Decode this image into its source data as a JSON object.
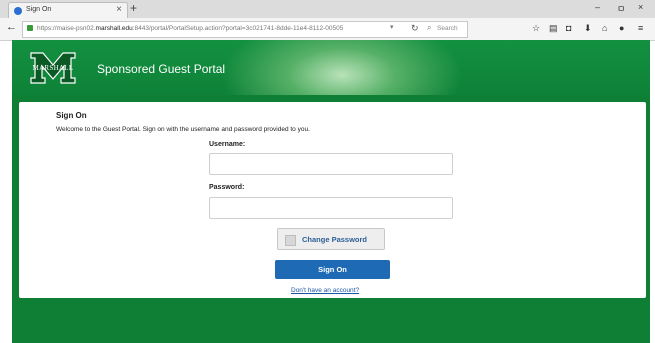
{
  "browser": {
    "tab_title": "Sign On",
    "tab_close": "×",
    "new_tab": "+",
    "window_controls": [
      "–",
      "ㅁ",
      "×"
    ],
    "url_prefix": "https://maise-psn02.",
    "url_domain": "marshall.edu",
    "url_rest": ":8443/portal/PortalSetup.action?portal=3c021741-8dde-11e4-8112-00505",
    "url_dropdown": "▾",
    "search_placeholder": "Search"
  },
  "portal": {
    "logo_text": "MARSHALL",
    "title": "Sponsored Guest Portal"
  },
  "signon": {
    "heading": "Sign On",
    "welcome": "Welcome to the Guest Portal. Sign on with the username and password provided to you.",
    "username_label": "Username:",
    "username_value": "",
    "password_label": "Password:",
    "password_value": "",
    "change_password_label": "Change Password",
    "signon_button": "Sign On",
    "no_account_link": "Don't have an account?"
  },
  "colors": {
    "brand_green": "#0f7f36",
    "primary_button": "#1e6ab5",
    "link": "#1a56a6"
  }
}
